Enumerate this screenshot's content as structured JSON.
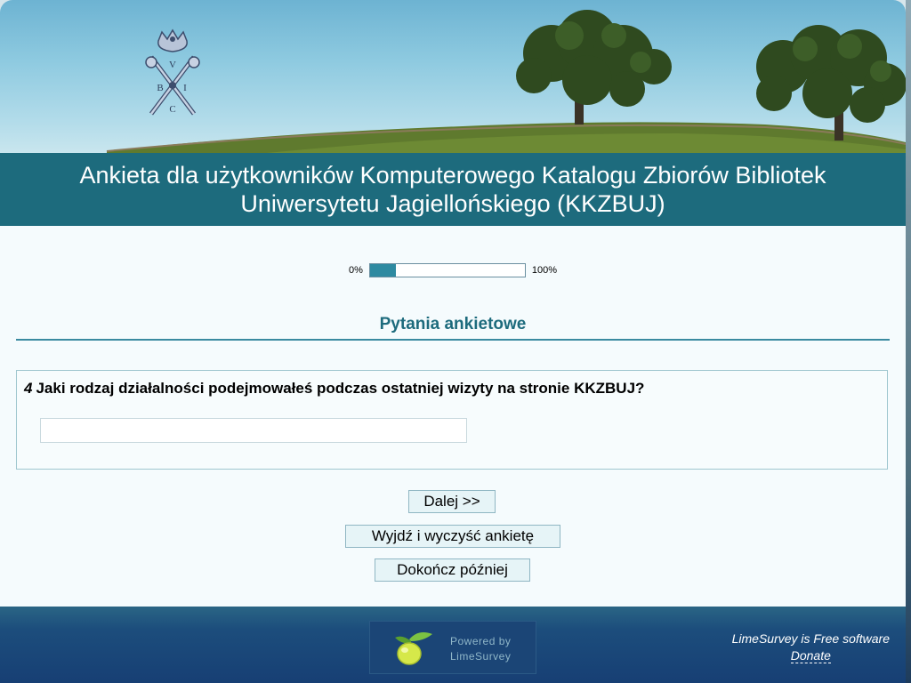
{
  "survey": {
    "title": "Ankieta dla użytkowników Komputerowego Katalogu Zbiorów Bibliotek Uniwersytetu Jagiellońskiego (KKZBUJ)"
  },
  "progress": {
    "left_label": "0%",
    "right_label": "100%",
    "value_fraction": 0.17
  },
  "group": {
    "title": "Pytania ankietowe"
  },
  "question": {
    "number": "4",
    "text": "Jaki rodzaj działalności podejmowałeś podczas ostatniej wizyty na stronie KKZBUJ?",
    "answer_value": ""
  },
  "buttons": {
    "next": "Dalej >>",
    "clear": "Wyjdź i wyczyść ankietę",
    "later": "Dokończ później"
  },
  "footer": {
    "powered_line1": "Powered by",
    "powered_line2": "LimeSurvey",
    "free_text": "LimeSurvey is Free software",
    "donate": "Donate",
    "logo_icon": "lime-icon"
  },
  "colors": {
    "title_bar": "#1d6b7d",
    "accent": "#2e8aa1",
    "footer": "#173f74"
  }
}
